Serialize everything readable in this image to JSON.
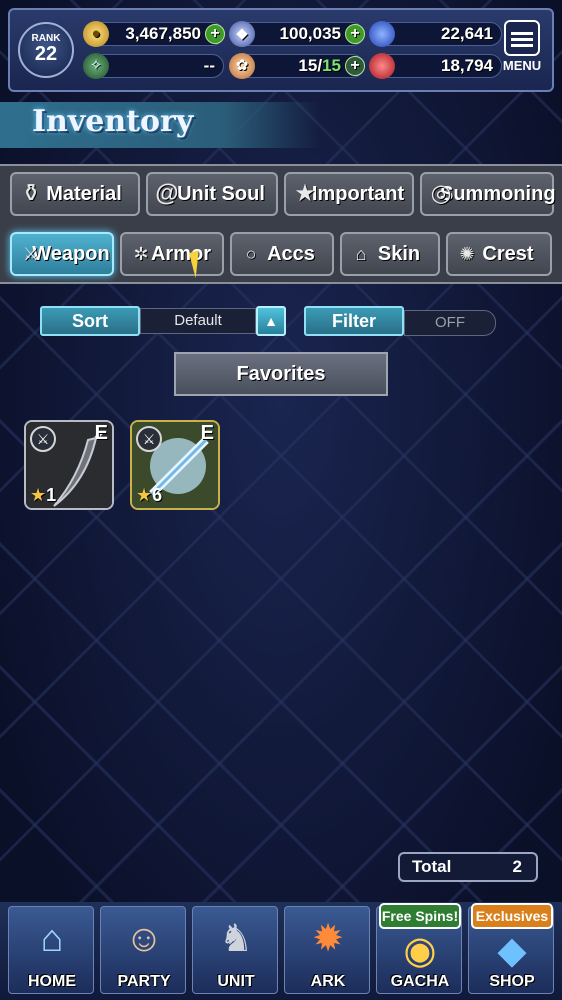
{
  "header": {
    "rank_label": "RANK",
    "rank_value": "22",
    "gold": "3,467,850",
    "crystals": "100,035",
    "blue_orbs": "22,641",
    "green_value": "--",
    "stamina": "15",
    "stamina_max": "15",
    "stamina_sep": "/",
    "red_gems": "18,794",
    "menu_label": "MENU"
  },
  "page": {
    "title": "Inventory"
  },
  "categories": [
    {
      "label": "Material",
      "icon": "bag-icon"
    },
    {
      "label": "Unit Soul",
      "icon": "soul-icon"
    },
    {
      "label": "Important",
      "icon": "star-icon"
    },
    {
      "label": "Summoning",
      "icon": "summon-icon"
    }
  ],
  "equipment_tabs": [
    {
      "label": "Weapon",
      "icon": "sword-icon",
      "active": true
    },
    {
      "label": "Armor",
      "icon": "armor-icon",
      "active": false
    },
    {
      "label": "Accs",
      "icon": "ring-icon",
      "active": false
    },
    {
      "label": "Skin",
      "icon": "hanger-icon",
      "active": false
    },
    {
      "label": "Crest",
      "icon": "crest-icon",
      "active": false
    }
  ],
  "sort": {
    "label": "Sort",
    "value": "Default"
  },
  "filter": {
    "label": "Filter",
    "value": "OFF"
  },
  "favorites_label": "Favorites",
  "items": [
    {
      "grade": "E",
      "stars": "1",
      "type_icon": "sword-icon",
      "name": "curved-blade"
    },
    {
      "grade": "E",
      "stars": "6",
      "type_icon": "sword-icon",
      "name": "ice-blade"
    }
  ],
  "total": {
    "label": "Total",
    "value": "2"
  },
  "nav": [
    {
      "label": "HOME",
      "icon": "home-icon"
    },
    {
      "label": "PARTY",
      "icon": "party-icon"
    },
    {
      "label": "UNIT",
      "icon": "unit-icon"
    },
    {
      "label": "ARK",
      "icon": "ark-icon"
    },
    {
      "label": "GACHA",
      "icon": "gacha-icon",
      "badge": "Free Spins!"
    },
    {
      "label": "SHOP",
      "icon": "shop-icon",
      "badge": "Exclusives"
    }
  ],
  "colors": {
    "active_tab": "#3fa3c2",
    "star": "#f5c542",
    "badge_green": "#2e7d32",
    "badge_orange": "#d9801c"
  }
}
